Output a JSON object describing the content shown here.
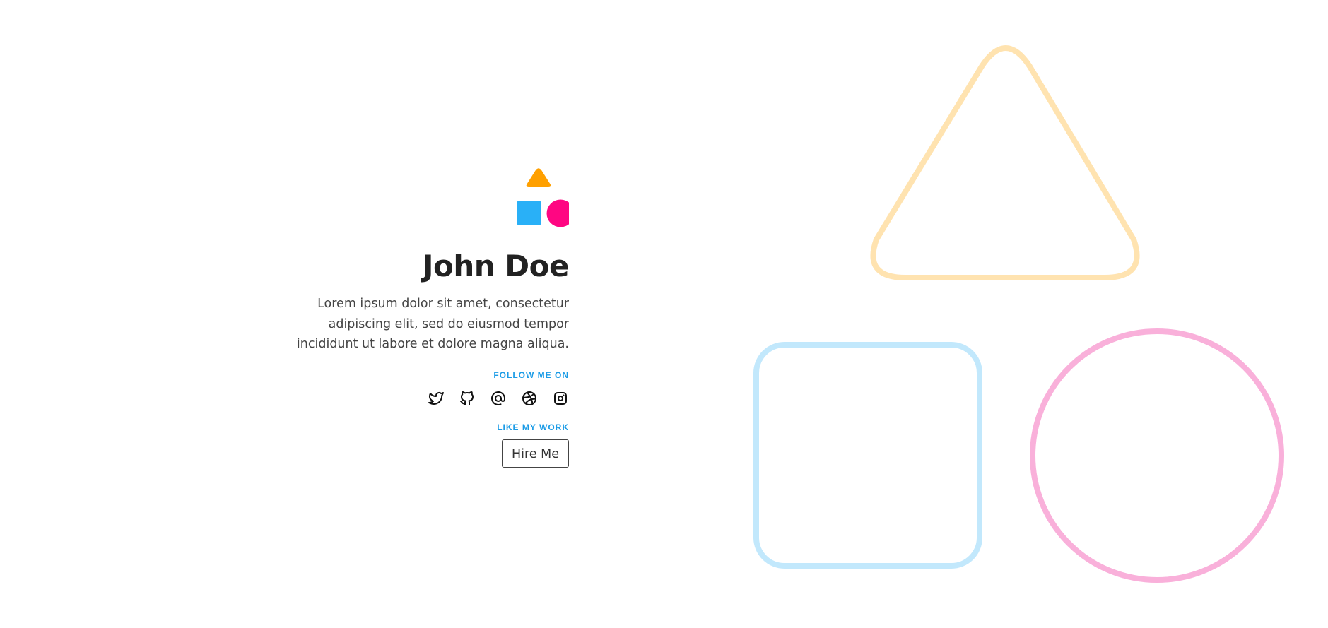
{
  "profile": {
    "name": "John Doe",
    "bio": "Lorem ipsum dolor sit amet, consectetur adipiscing elit, sed do eiusmod tempor incididunt ut labore et dolore magna aliqua.",
    "follow_label": "FOLLOW ME ON",
    "work_label": "LIKE MY WORK",
    "hire_button": "Hire Me"
  },
  "logo": {
    "icons": [
      "triangle-icon",
      "square-icon",
      "circle-icon"
    ]
  },
  "social": {
    "icons": [
      "twitter-icon",
      "github-icon",
      "at-sign-icon",
      "dribbble-icon",
      "instagram-icon"
    ]
  },
  "colors": {
    "orange": "#ffa000",
    "blue": "#29b0f7",
    "pink": "#ff0682",
    "accent": "#1a9be6",
    "deco_orange": "#ffe3b0",
    "deco_blue": "#c2e8fc",
    "deco_pink": "#f9b0da"
  }
}
